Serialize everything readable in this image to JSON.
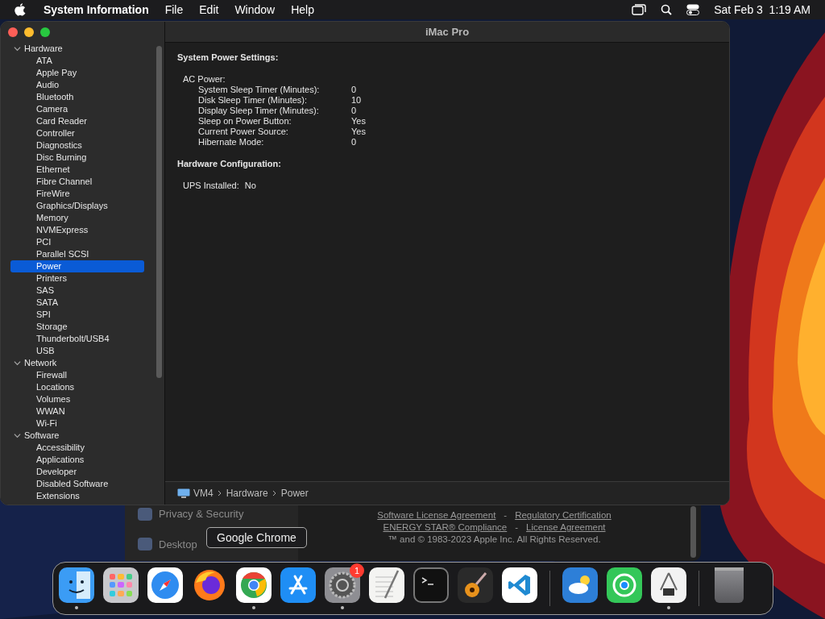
{
  "menu_bar": {
    "app_name": "System Information",
    "menus": [
      "File",
      "Edit",
      "Window",
      "Help"
    ],
    "clock": "Sat Feb 3  1:19 AM"
  },
  "window": {
    "title": "iMac Pro",
    "sidebar": [
      {
        "label": "Hardware",
        "expanded": true,
        "children": [
          {
            "label": "ATA",
            "selected": false
          },
          {
            "label": "Apple Pay",
            "selected": false
          },
          {
            "label": "Audio",
            "selected": false
          },
          {
            "label": "Bluetooth",
            "selected": false
          },
          {
            "label": "Camera",
            "selected": false
          },
          {
            "label": "Card Reader",
            "selected": false
          },
          {
            "label": "Controller",
            "selected": false
          },
          {
            "label": "Diagnostics",
            "selected": false
          },
          {
            "label": "Disc Burning",
            "selected": false
          },
          {
            "label": "Ethernet",
            "selected": false
          },
          {
            "label": "Fibre Channel",
            "selected": false
          },
          {
            "label": "FireWire",
            "selected": false
          },
          {
            "label": "Graphics/Displays",
            "selected": false
          },
          {
            "label": "Memory",
            "selected": false
          },
          {
            "label": "NVMExpress",
            "selected": false
          },
          {
            "label": "PCI",
            "selected": false
          },
          {
            "label": "Parallel SCSI",
            "selected": false
          },
          {
            "label": "Power",
            "selected": true
          },
          {
            "label": "Printers",
            "selected": false
          },
          {
            "label": "SAS",
            "selected": false
          },
          {
            "label": "SATA",
            "selected": false
          },
          {
            "label": "SPI",
            "selected": false
          },
          {
            "label": "Storage",
            "selected": false
          },
          {
            "label": "Thunderbolt/USB4",
            "selected": false
          },
          {
            "label": "USB",
            "selected": false
          }
        ]
      },
      {
        "label": "Network",
        "expanded": true,
        "children": [
          {
            "label": "Firewall",
            "selected": false
          },
          {
            "label": "Locations",
            "selected": false
          },
          {
            "label": "Volumes",
            "selected": false
          },
          {
            "label": "WWAN",
            "selected": false
          },
          {
            "label": "Wi-Fi",
            "selected": false
          }
        ]
      },
      {
        "label": "Software",
        "expanded": true,
        "children": [
          {
            "label": "Accessibility",
            "selected": false
          },
          {
            "label": "Applications",
            "selected": false
          },
          {
            "label": "Developer",
            "selected": false
          },
          {
            "label": "Disabled Software",
            "selected": false
          },
          {
            "label": "Extensions",
            "selected": false
          }
        ]
      }
    ],
    "sections": [
      {
        "heading": "System Power Settings:",
        "groups": [
          {
            "label": "AC Power:",
            "rows": [
              {
                "key": "System Sleep Timer (Minutes):",
                "value": "0"
              },
              {
                "key": "Disk Sleep Timer (Minutes):",
                "value": "10"
              },
              {
                "key": "Display Sleep Timer (Minutes):",
                "value": "0"
              },
              {
                "key": "Sleep on Power Button:",
                "value": "Yes"
              },
              {
                "key": "Current Power Source:",
                "value": "Yes"
              },
              {
                "key": "Hibernate Mode:",
                "value": "0"
              }
            ]
          }
        ]
      },
      {
        "heading": "Hardware Configuration:",
        "pairs": [
          {
            "key": "UPS Installed:",
            "value": "No"
          }
        ]
      }
    ],
    "breadcrumb": [
      "VM4",
      "Hardware",
      "Power"
    ]
  },
  "background_window": {
    "sidebar_items": [
      "Privacy & Security",
      "Desktop"
    ],
    "links": [
      [
        "Software License Agreement",
        "Regulatory Certification"
      ],
      [
        "ENERGY STAR® Compliance",
        "License Agreement"
      ]
    ],
    "link_separator": "-",
    "copyright": "™ and © 1983-2023 Apple Inc. All Rights Reserved."
  },
  "tooltip": "Google Chrome",
  "dock": [
    {
      "kind": "finder",
      "running": true
    },
    {
      "kind": "launchpad",
      "running": false
    },
    {
      "kind": "safari",
      "running": false
    },
    {
      "kind": "firefox",
      "running": false
    },
    {
      "kind": "chrome",
      "running": true
    },
    {
      "kind": "appstore",
      "running": false
    },
    {
      "kind": "settings",
      "running": true,
      "badge": "1"
    },
    {
      "kind": "textedit",
      "running": false
    },
    {
      "kind": "terminal",
      "running": false
    },
    {
      "kind": "garageband",
      "running": false
    },
    {
      "kind": "vscode",
      "running": false
    },
    {
      "kind": "divider"
    },
    {
      "kind": "weather",
      "running": false
    },
    {
      "kind": "findmy",
      "running": false
    },
    {
      "kind": "sysinfo",
      "running": true
    },
    {
      "kind": "divider"
    },
    {
      "kind": "trash",
      "running": false
    }
  ]
}
